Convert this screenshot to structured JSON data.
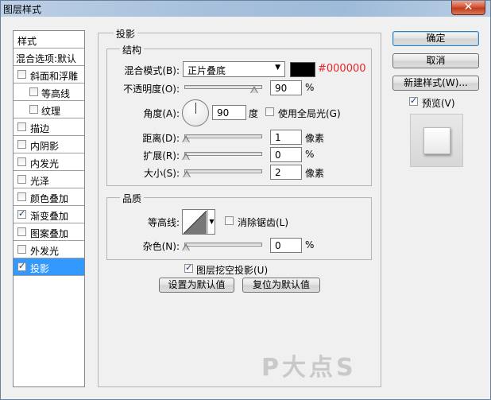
{
  "window": {
    "title": "图层样式",
    "close_glyph": "✕"
  },
  "style_list": {
    "items": [
      {
        "label": "样式",
        "type": "header"
      },
      {
        "label": "混合选项:默认",
        "type": "header"
      },
      {
        "label": "斜面和浮雕",
        "checked": false
      },
      {
        "label": "等高线",
        "checked": false,
        "sub": true
      },
      {
        "label": "纹理",
        "checked": false,
        "sub": true
      },
      {
        "label": "描边",
        "checked": false
      },
      {
        "label": "内阴影",
        "checked": false
      },
      {
        "label": "内发光",
        "checked": false
      },
      {
        "label": "光泽",
        "checked": false
      },
      {
        "label": "颜色叠加",
        "checked": false
      },
      {
        "label": "渐变叠加",
        "checked": true
      },
      {
        "label": "图案叠加",
        "checked": false
      },
      {
        "label": "外发光",
        "checked": false
      },
      {
        "label": "投影",
        "checked": true,
        "selected": true
      }
    ]
  },
  "panel": {
    "title": "投影",
    "structure": {
      "title": "结构",
      "blend_mode_label": "混合模式(B):",
      "blend_mode_value": "正片叠底",
      "color_hex": "#000000",
      "opacity_label": "不透明度(O):",
      "opacity_value": "90",
      "opacity_unit": "%",
      "angle_label": "角度(A):",
      "angle_value": "90",
      "angle_unit": "度",
      "global_light_label": "使用全局光(G)",
      "global_light_checked": false,
      "distance_label": "距离(D):",
      "distance_value": "1",
      "distance_unit": "像素",
      "spread_label": "扩展(R):",
      "spread_value": "0",
      "spread_unit": "%",
      "size_label": "大小(S):",
      "size_value": "2",
      "size_unit": "像素"
    },
    "quality": {
      "title": "品质",
      "contour_label": "等高线:",
      "anti_alias_label": "消除锯齿(L)",
      "anti_alias_checked": false,
      "noise_label": "杂色(N):",
      "noise_value": "0",
      "noise_unit": "%"
    },
    "knockout_label": "图层挖空投影(U)",
    "knockout_checked": true,
    "set_default_label": "设置为默认值",
    "reset_default_label": "复位为默认值"
  },
  "buttons": {
    "ok": "确定",
    "cancel": "取消",
    "new_style": "新建样式(W)...",
    "preview_label": "预览(V)",
    "preview_checked": true
  },
  "watermark": "P大点S",
  "colors": {
    "accent_selected": "#3399ff",
    "hex_text": "#e8262a"
  }
}
